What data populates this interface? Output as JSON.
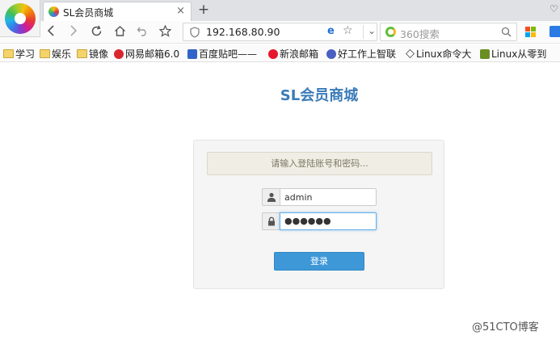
{
  "browser": {
    "tab": {
      "title": "SL会员商城",
      "close": "×"
    },
    "new_tab": "+",
    "menu_glyph": "♡",
    "address": {
      "url": "192.168.80.90",
      "engine_badge": "e",
      "star": "☆",
      "dropdown": "⌄"
    },
    "search": {
      "placeholder": "360搜索"
    },
    "bookmarks": [
      {
        "label": "学习",
        "icon": "folder-icon"
      },
      {
        "label": "娱乐",
        "icon": "folder-icon"
      },
      {
        "label": "镜像",
        "icon": "folder-icon"
      },
      {
        "label": "网易邮箱6.0",
        "icon": "netease-icon"
      },
      {
        "label": "百度贴吧——",
        "icon": "baidu-icon"
      },
      {
        "label": "新浪邮箱",
        "icon": "sina-icon"
      },
      {
        "label": "好工作上智联",
        "icon": "zhaopin-icon"
      },
      {
        "label": "Linux命令大",
        "icon": "linux-icon"
      },
      {
        "label": "Linux从零到",
        "icon": "linux-book-icon"
      }
    ]
  },
  "page": {
    "title": "SL会员商城",
    "login": {
      "hint": "请输入登陆账号和密码...",
      "username": "admin",
      "password_mask": "●●●●●●",
      "button_label": "登录"
    }
  },
  "watermark": "@51CTO博客",
  "colors": {
    "title_blue": "#3a7bb8",
    "button_blue": "#3e98d8",
    "hint_bg": "#efede4",
    "focus_border": "#66afe9"
  }
}
